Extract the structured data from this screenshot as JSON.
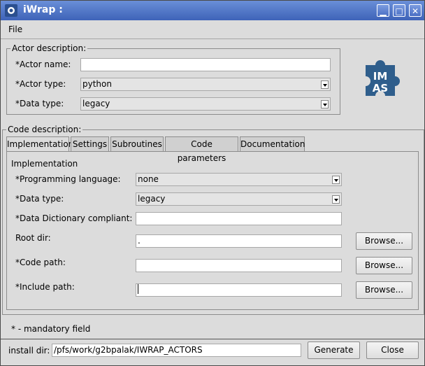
{
  "window": {
    "title": "iWrap :",
    "minimize_glyph": "▁",
    "maximize_glyph": "□",
    "close_glyph": "✕"
  },
  "menu": {
    "file": "File"
  },
  "actor": {
    "group_title": "Actor description:",
    "name_label": "*Actor name:",
    "name_value": "",
    "type_label": "*Actor type:",
    "type_value": "python",
    "datatype_label": "*Data type:",
    "datatype_value": "legacy"
  },
  "logo": {
    "text": "IMAS",
    "color": "#2f5e8c"
  },
  "code": {
    "group_title": "Code description:",
    "tabs": [
      "Implementation",
      "Settings",
      "Subroutines",
      "Code parameters",
      "Documentation"
    ],
    "panel_title": "Implementation",
    "prog_lang_label": "*Programming language:",
    "prog_lang_value": "none",
    "datatype_label": "*Data type:",
    "datatype_value": "legacy",
    "dd_label": "*Data Dictionary compliant:",
    "dd_value": "",
    "root_label": "Root dir:",
    "root_value": ".",
    "code_path_label": "*Code path:",
    "code_path_value": "",
    "include_label": "*Include path:",
    "include_value": "",
    "browse": "Browse..."
  },
  "mandatory_note": "* - mandatory field",
  "footer": {
    "install_label": "install dir:",
    "install_value": "/pfs/work/g2bpalak/IWRAP_ACTORS",
    "generate": "Generate",
    "close": "Close"
  }
}
